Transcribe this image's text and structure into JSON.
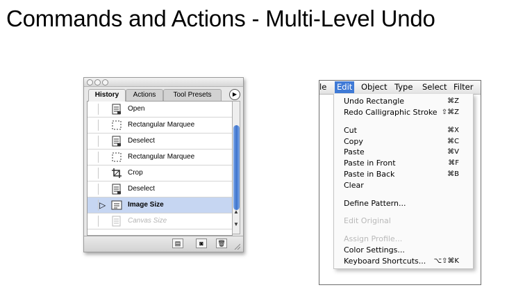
{
  "slide": {
    "title": "Commands and Actions - Multi-Level Undo"
  },
  "history_panel": {
    "tabs": [
      "History",
      "Actions",
      "Tool Presets"
    ],
    "active_tab": "History",
    "items": [
      {
        "label": "Open",
        "icon": "document-icon",
        "state": "normal"
      },
      {
        "label": "Rectangular Marquee",
        "icon": "marquee-icon",
        "state": "normal"
      },
      {
        "label": "Deselect",
        "icon": "document-icon",
        "state": "normal"
      },
      {
        "label": "Rectangular Marquee",
        "icon": "marquee-icon",
        "state": "normal"
      },
      {
        "label": "Crop",
        "icon": "crop-icon",
        "state": "normal"
      },
      {
        "label": "Deselect",
        "icon": "document-icon",
        "state": "normal"
      },
      {
        "label": "Image Size",
        "icon": "image-size-icon",
        "state": "selected"
      },
      {
        "label": "Canvas Size",
        "icon": "document-icon",
        "state": "undone"
      }
    ],
    "bottom_buttons": [
      "new-document-from-state-icon",
      "new-snapshot-icon",
      "trash-icon"
    ]
  },
  "menu": {
    "menubar": [
      "le",
      "Edit",
      "Object",
      "Type",
      "Select",
      "Filter"
    ],
    "active_menu": "Edit",
    "items": [
      {
        "label": "Undo Rectangle",
        "shortcut": "⌘Z",
        "enabled": true
      },
      {
        "label": "Redo Calligraphic Stroke",
        "shortcut": "⇧⌘Z",
        "enabled": true
      },
      {
        "label": "Cut",
        "shortcut": "⌘X",
        "enabled": true
      },
      {
        "label": "Copy",
        "shortcut": "⌘C",
        "enabled": true
      },
      {
        "label": "Paste",
        "shortcut": "⌘V",
        "enabled": true
      },
      {
        "label": "Paste in Front",
        "shortcut": "⌘F",
        "enabled": true
      },
      {
        "label": "Paste in Back",
        "shortcut": "⌘B",
        "enabled": true
      },
      {
        "label": "Clear",
        "shortcut": "",
        "enabled": true
      },
      {
        "label": "Define Pattern...",
        "shortcut": "",
        "enabled": true
      },
      {
        "label": "Edit Original",
        "shortcut": "",
        "enabled": false
      },
      {
        "label": "Assign Profile...",
        "shortcut": "",
        "enabled": false
      },
      {
        "label": "Color Settings...",
        "shortcut": "",
        "enabled": true
      },
      {
        "label": "Keyboard Shortcuts...",
        "shortcut": "⌥⇧⌘K",
        "enabled": true
      }
    ]
  }
}
